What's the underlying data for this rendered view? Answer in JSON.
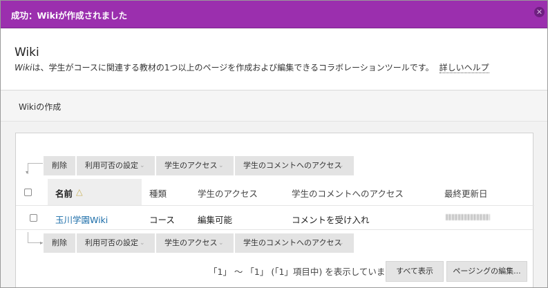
{
  "banner": {
    "message": "成功：Wikiが作成されました",
    "close_glyph": "✕",
    "color": "#9b2fae"
  },
  "header": {
    "title": "Wiki",
    "desc_em": "Wiki",
    "desc_rest": "は、学生がコースに関連する教材の1つ以上のページを作成および編集できるコラボレーションツールです。",
    "help_link": "詳しいヘルプ"
  },
  "section": {
    "title": "Wikiの作成"
  },
  "actions": {
    "delete": "削除",
    "availability": "利用可否の設定",
    "student_access": "学生のアクセス",
    "comment_access": "学生のコメントへのアクセス"
  },
  "table": {
    "headers": {
      "name": "名前",
      "name_sort_icon": "△",
      "type": "種類",
      "student_access": "学生のアクセス",
      "comment_access": "学生のコメントへのアクセス",
      "last_updated": "最終更新日"
    },
    "rows": [
      {
        "name": "玉川学園Wiki",
        "type": "コース",
        "student_access": "編集可能",
        "comment_access": "コメントを受け入れ"
      }
    ]
  },
  "pagination": {
    "summary": "「1」 ～ 「1」 (「1」項目中) を表示しています",
    "show_all": "すべて表示",
    "edit_paging": "ページングの編集..."
  }
}
